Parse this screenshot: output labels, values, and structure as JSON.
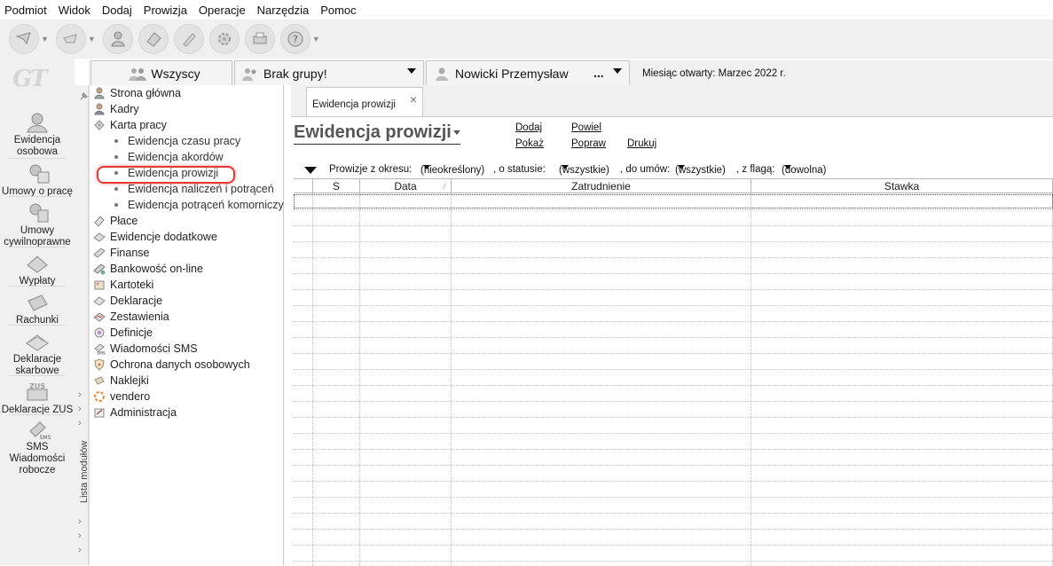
{
  "menu": [
    "Podmiot",
    "Widok",
    "Dodaj",
    "Prowizja",
    "Operacje",
    "Narzędzia",
    "Pomoc"
  ],
  "toolbar": {
    "buttons": [
      "nav-icon",
      "nav-alt-icon",
      "operator-icon",
      "eraser-icon",
      "pen-icon",
      "gear-icon",
      "print-icon",
      "help-icon"
    ]
  },
  "rail": {
    "logo": "GT",
    "items": [
      {
        "label": "Ewidencja osobowa",
        "icon": "person-icon"
      },
      {
        "label": "Umowy o pracę",
        "icon": "contract-icon"
      },
      {
        "label": "Umowy cywilnoprawne",
        "icon": "civil-contract-icon"
      },
      {
        "label": "Wypłaty",
        "icon": "payout-icon"
      },
      {
        "label": "Rachunki",
        "icon": "invoice-icon"
      },
      {
        "label": "Deklaracje skarbowe",
        "icon": "tax-declaration-icon"
      },
      {
        "label": "Deklaracje ZUS",
        "icon": "zus-icon"
      },
      {
        "label": "SMS Wiadomości robocze",
        "icon": "sms-icon"
      }
    ]
  },
  "modstrip": {
    "label": "Lista modułów"
  },
  "groupbar": {
    "group_all": "Wszyscy",
    "group_none": "Brak grupy!",
    "employee": "Nowicki Przemysław",
    "employee_more": "...",
    "month_info": "Miesiąc otwarty:  Marzec 2022 r."
  },
  "tree": {
    "items": [
      {
        "label": "Strona główna",
        "icon": "home-icon"
      },
      {
        "label": "Kadry",
        "icon": "staff-icon"
      },
      {
        "label": "Karta pracy",
        "icon": "workcard-icon"
      },
      {
        "label": "Płace",
        "icon": "payroll-icon"
      },
      {
        "label": "Ewidencje dodatkowe",
        "icon": "records-icon"
      },
      {
        "label": "Finanse",
        "icon": "finance-icon"
      },
      {
        "label": "Bankowość on-line",
        "icon": "bank-icon"
      },
      {
        "label": "Kartoteki",
        "icon": "files-icon"
      },
      {
        "label": "Deklaracje",
        "icon": "declaration-icon"
      },
      {
        "label": "Zestawienia",
        "icon": "reports-icon"
      },
      {
        "label": "Definicje",
        "icon": "definitions-icon"
      },
      {
        "label": "Wiadomości SMS",
        "icon": "sms-small-icon"
      },
      {
        "label": "Ochrona danych osobowych",
        "icon": "shield-icon"
      },
      {
        "label": "Naklejki",
        "icon": "sticker-icon"
      },
      {
        "label": "vendero",
        "icon": "vendero-icon"
      },
      {
        "label": "Administracja",
        "icon": "admin-icon"
      }
    ],
    "subitems": [
      "Ewidencja czasu pracy",
      "Ewidencja akordów",
      "Ewidencja prowizji",
      "Ewidencja naliczeń i potrąceń",
      "Ewidencja potrąceń komorniczy"
    ]
  },
  "tab": {
    "label": "Ewidencja prowizji",
    "close": "×"
  },
  "panel": {
    "title": "Ewidencja prowizji",
    "actions": {
      "dodaj": "Dodaj",
      "powiel": "Powiel",
      "pokaz": "Pokaż",
      "popraw": "Popraw",
      "drukuj": "Drukuj"
    }
  },
  "filter": {
    "label_period": "Prowizje z okresu:",
    "period": "(nieokreślony)",
    "label_status": ", o statusie:",
    "status": "(wszystkie)",
    "label_contracts": ", do umów:",
    "contracts": "(wszystkie)",
    "label_flag": ", z flagą:",
    "flag": "(dowolna)"
  },
  "grid": {
    "columns": [
      "",
      "S",
      "Data",
      "Zatrudnienie",
      "Stawka"
    ],
    "rows": []
  }
}
